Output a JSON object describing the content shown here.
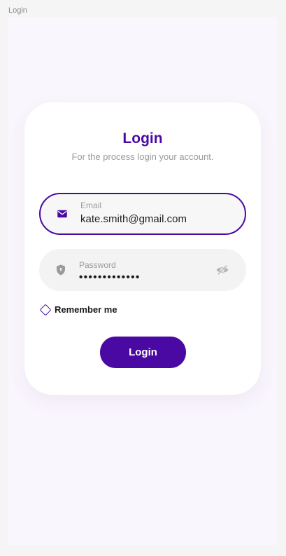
{
  "frame": {
    "label": "Login"
  },
  "card": {
    "title": "Login",
    "subtitle": "For the process login your account."
  },
  "email": {
    "label": "Email",
    "value": "kate.smith@gmail.com",
    "icon": "mail-icon"
  },
  "password": {
    "label": "Password",
    "value": "•••••••••••••",
    "icon": "shield-icon",
    "toggle_icon": "eye-off-icon"
  },
  "remember": {
    "label": "Remember me",
    "checked": false
  },
  "login_button": {
    "label": "Login"
  },
  "colors": {
    "accent": "#4b09a4",
    "frame_bg": "#faf6fd",
    "field_bg": "#f3f3f3"
  }
}
